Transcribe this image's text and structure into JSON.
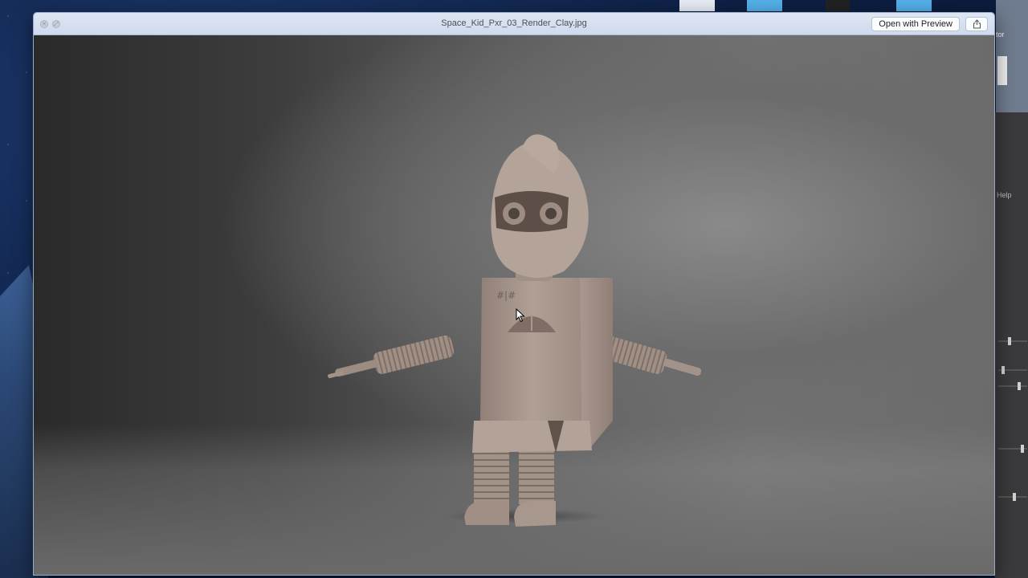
{
  "window": {
    "title": "Space_Kid_Pxr_03_Render_Clay.jpg",
    "open_with_label": "Open with Preview",
    "share_icon": "share-icon",
    "close_icon": "close-icon",
    "zoom_icon": "fullscreen-icon"
  },
  "background_app": {
    "help_label": "Help",
    "partial_label": "tor"
  },
  "colors": {
    "titlebar": "#d6e0ef",
    "clay": "#a8968c",
    "desktop": "#0f2147"
  }
}
